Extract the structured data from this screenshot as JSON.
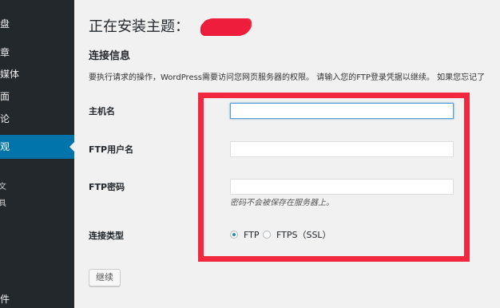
{
  "sidebar": {
    "items": [
      {
        "key": "dash",
        "label": "仪表盘"
      },
      {
        "key": "posts",
        "label": "文章"
      },
      {
        "key": "media",
        "label": "多媒体"
      },
      {
        "key": "pages",
        "label": "页面"
      },
      {
        "key": "comments",
        "label": "评论"
      },
      {
        "key": "appearance",
        "label": "外观",
        "active": true
      },
      {
        "key": "plugins",
        "label": "插件"
      }
    ],
    "submenu": [
      "文",
      "具"
    ],
    "visible_fragments": {
      "dash": "仪表盘",
      "posts": "文章",
      "media": "多媒体",
      "pages": "页面",
      "comments": "评论",
      "appearance": "外观",
      "plugins": "插件"
    },
    "active_color": "#0073aa",
    "background": "#23282d"
  },
  "page": {
    "title": "正在安装主题：",
    "section_title": "连接信息",
    "instructions": "要执行请求的操作，WordPress需要访问您网页服务器的权限。 请输入您的FTP登录凭据以继续。 如果您忘记了",
    "fields": {
      "hostname_label": "主机名",
      "hostname_value": "",
      "username_label": "FTP用户名",
      "username_value": "",
      "password_label": "FTP密码",
      "password_value": "",
      "password_hint": "密码不会被保存在服务器上。"
    },
    "connection_type": {
      "label": "连接类型",
      "options": [
        "FTP",
        "FTPS（SSL）"
      ],
      "selected": "FTP"
    },
    "continue_button": "继续"
  },
  "colors": {
    "annotation_border": "#f2283f",
    "redaction": "#ef1d3c",
    "radio_checked": "#1e8cbe"
  }
}
